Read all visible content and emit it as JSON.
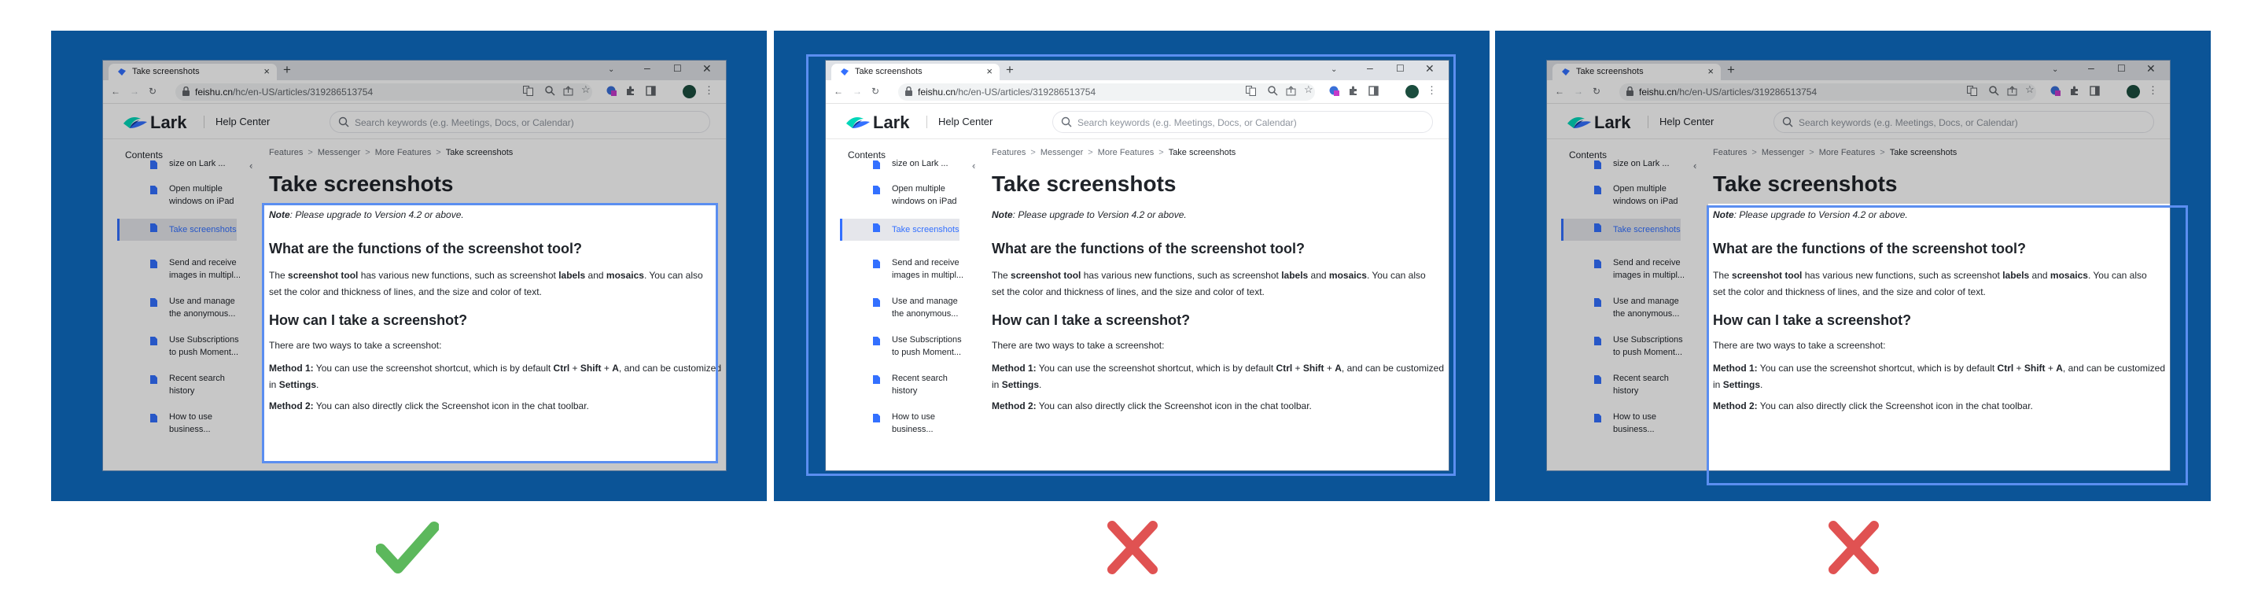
{
  "browser": {
    "tab_title": "Take screenshots",
    "new_tab": "+",
    "url_host": "feishu.cn",
    "url_path": "/hc/en-US/articles/319286513754"
  },
  "site": {
    "logo_text": "Lark",
    "help_center": "Help Center",
    "search_placeholder": "Search keywords (e.g. Meetings, Docs, or Calendar)"
  },
  "sidebar": {
    "heading": "Contents",
    "collapse_icon": "«",
    "items": [
      {
        "line1": "size on Lark ...",
        "line2": "",
        "partial": true
      },
      {
        "line1": "Open multiple",
        "line2": "windows on iPad"
      },
      {
        "line1": "Take screenshots",
        "line2": "",
        "active": true
      },
      {
        "line1": "Send and receive",
        "line2": "images in multipl..."
      },
      {
        "line1": "Use and manage",
        "line2": "the anonymous..."
      },
      {
        "line1": "Use Subscriptions",
        "line2": "to push Moment..."
      },
      {
        "line1": "Recent search",
        "line2": "history"
      },
      {
        "line1": "How to use",
        "line2": "business..."
      }
    ]
  },
  "breadcrumbs": [
    "Features",
    "Messenger",
    "More Features",
    "Take screenshots"
  ],
  "article": {
    "title": "Take screenshots",
    "note_label": "Note",
    "note_text": ": Please upgrade to Version 4.2 or above.",
    "h2_functions": "What are the functions of the screenshot tool?",
    "p_functions_a": "The ",
    "p_functions_b": "screenshot tool",
    "p_functions_c": " has various new functions, such as screenshot ",
    "p_functions_d": "labels",
    "p_functions_e": " and ",
    "p_functions_f": "mosaics",
    "p_functions_g": ". You can also set the color and thickness of lines, and the size and color of text.",
    "h2_how": "How can I take a screenshot?",
    "p_ways": "There are two ways to take a screenshot:",
    "m1_label": "Method 1:",
    "m1_a": " You can use the screenshot shortcut, which is by default ",
    "m1_ctrl": "Ctrl",
    "m1_plus1": " + ",
    "m1_shift": "Shift",
    "m1_plus2": " + ",
    "m1_a_key": "A",
    "m1_b": ", and can be customized in ",
    "m1_settings": "Settings",
    "m1_end": ".",
    "m2_label": "Method 2:",
    "m2_text": " You can also directly click the Screenshot icon in the chat toolbar."
  },
  "marks": {
    "correct": "check-mark",
    "wrong": "x-mark",
    "correct_color": "#5cb85c",
    "wrong_color": "#e05252",
    "highlight_color": "#5b8ef0",
    "background_color": "#0b5497"
  }
}
